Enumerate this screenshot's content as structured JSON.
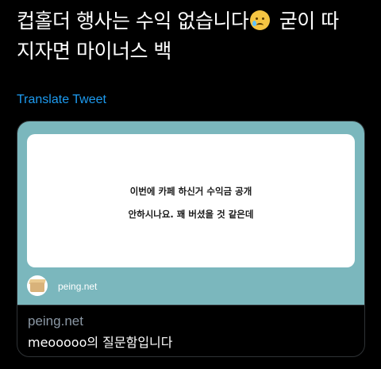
{
  "tweet": {
    "text_line1": "컵홀더 행사는 수익 없습니다",
    "text_line1_tail": "굳이 따",
    "text_line2": "지자면 마이너스 백",
    "emoji": "face-holding-back-tears"
  },
  "translate_link": "Translate Tweet",
  "card": {
    "question_line1": "이번에 카페 하신거 수익금 공개",
    "question_line2": "안하시나요. 꽤 버셨을 것 같은데",
    "footer_domain": "peing.net",
    "avatar_icon": "box-icon",
    "info_domain": "peing.net",
    "info_title": "meooooo의 질문함입니다"
  },
  "colors": {
    "background": "#000000",
    "link": "#1d9bf0",
    "card_teal": "#7bb7bd",
    "muted": "#8b98a5"
  }
}
